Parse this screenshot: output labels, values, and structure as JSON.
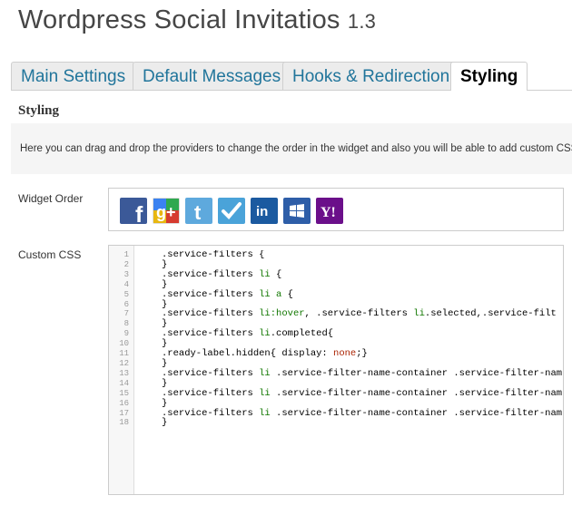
{
  "header": {
    "title": "Wordpress Social Invitatios",
    "version": "1.3"
  },
  "tabs": [
    {
      "label": "Main Settings",
      "active": false
    },
    {
      "label": "Default Messages",
      "active": false
    },
    {
      "label": "Hooks & Redirection",
      "active": false
    },
    {
      "label": "Styling",
      "active": true
    }
  ],
  "section": {
    "title": "Styling",
    "description": "Here you can drag and drop the providers to change the order in the widget and also you will be able to add custom CSS."
  },
  "widget_order": {
    "label": "Widget Order",
    "providers": [
      {
        "name": "facebook",
        "icon": "facebook-icon",
        "color": "#3b5998"
      },
      {
        "name": "google",
        "icon": "google-icon",
        "color": "#ffffff"
      },
      {
        "name": "twitter",
        "icon": "twitter-icon",
        "color": "#5ea9dd"
      },
      {
        "name": "foursquare",
        "icon": "foursquare-icon",
        "color": "#4aa3d9"
      },
      {
        "name": "linkedin",
        "icon": "linkedin-icon",
        "color": "#1b5aa0"
      },
      {
        "name": "windows-live",
        "icon": "windows-live-icon",
        "color": "#2e5ea8"
      },
      {
        "name": "yahoo",
        "icon": "yahoo-icon",
        "color": "#6b0f8a"
      }
    ]
  },
  "custom_css": {
    "label": "Custom CSS",
    "line_numbers": [
      "1",
      "2",
      "3",
      "4",
      "5",
      "6",
      "7",
      "8",
      "9",
      "10",
      "11",
      "12",
      "13",
      "14",
      "15",
      "16",
      "17",
      "18"
    ],
    "lines": [
      ".service-filters {",
      "}",
      ".service-filters li {",
      "}",
      ".service-filters li a {",
      "}",
      ".service-filters li:hover, .service-filters li.selected,.service-filt",
      "}",
      ".service-filters li.completed{",
      "}",
      ".ready-label.hidden{ display: none;}",
      "}",
      ".service-filters li .service-filter-name-container .service-filter-nam",
      "}",
      ".service-filters li .service-filter-name-container .service-filter-nam",
      "}",
      ".service-filters li .service-filter-name-container .service-filter-nam",
      "}"
    ]
  },
  "colors": {
    "link": "#21759b",
    "border": "#cccccc",
    "keyword": "#117700",
    "value": "#aa2200"
  }
}
